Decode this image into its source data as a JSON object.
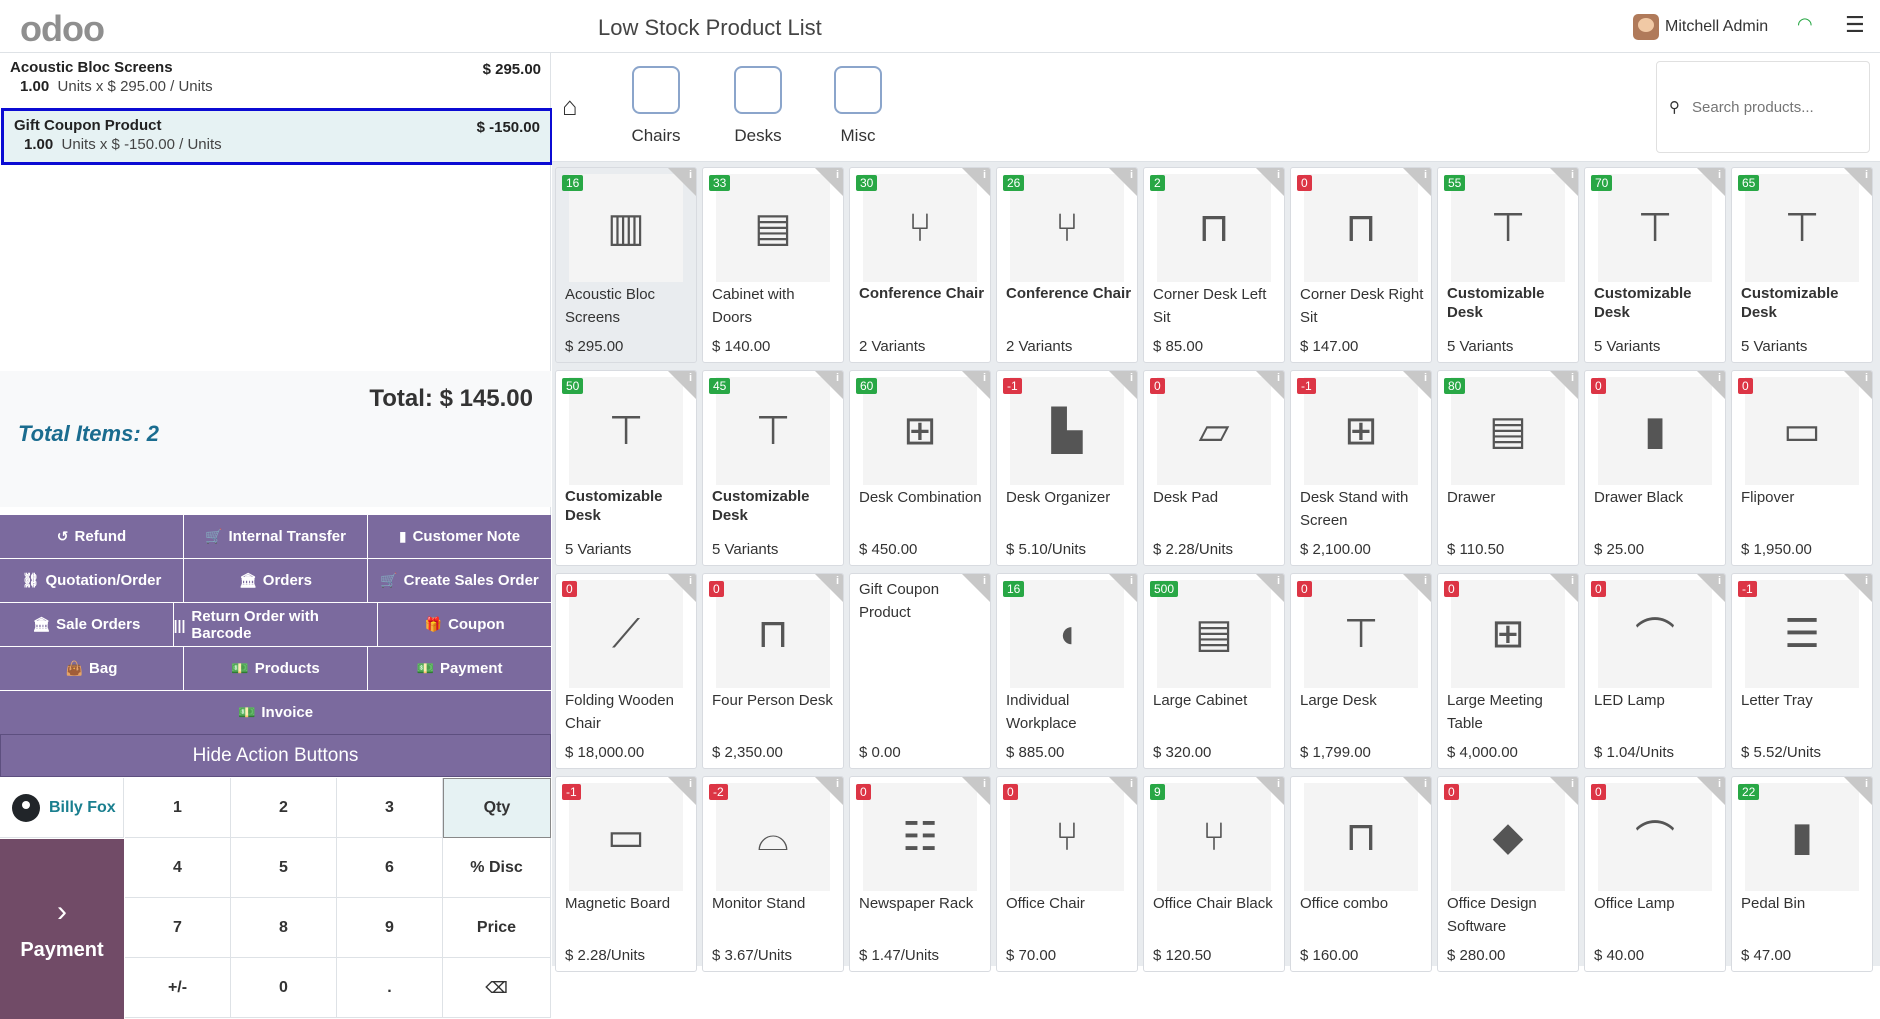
{
  "topbar": {
    "logo": "odoo",
    "title": "Low Stock Product List",
    "user": "Mitchell Admin"
  },
  "order": {
    "lines": [
      {
        "name": "Acoustic Bloc Screens",
        "price": "$ 295.00",
        "qty": "1.00",
        "unit_info": "Units x $ 295.00 / Units"
      },
      {
        "name": "Gift Coupon Product",
        "price": "$ -150.00",
        "qty": "1.00",
        "unit_info": "Units x $ -150.00 / Units"
      }
    ],
    "total": "Total: $ 145.00",
    "total_items": "Total Items: 2"
  },
  "actions": {
    "rows": [
      [
        {
          "label": "Refund",
          "icon": "undo-icon",
          "glyph": "↺"
        },
        {
          "label": "Internal Transfer",
          "icon": "cart-icon",
          "glyph": "🛒"
        },
        {
          "label": "Customer Note",
          "icon": "note-icon",
          "glyph": "▮"
        }
      ],
      [
        {
          "label": "Quotation/Order",
          "icon": "link-icon",
          "glyph": "⛓"
        },
        {
          "label": "Orders",
          "icon": "bank-icon",
          "glyph": "🏛"
        },
        {
          "label": "Create Sales Order",
          "icon": "cart-icon",
          "glyph": "🛒"
        }
      ],
      [
        {
          "label": "Sale Orders",
          "icon": "bank-icon",
          "glyph": "🏛"
        },
        {
          "label": "Return Order with Barcode",
          "icon": "barcode-icon",
          "glyph": "|||"
        },
        {
          "label": "Coupon",
          "icon": "gift-icon",
          "glyph": "🎁"
        }
      ],
      [
        {
          "label": "Bag",
          "icon": "bag-icon",
          "glyph": "👜"
        },
        {
          "label": "Products",
          "icon": "money-icon",
          "glyph": "💵"
        },
        {
          "label": "Payment",
          "icon": "money-icon",
          "glyph": "💵"
        }
      ],
      [
        {
          "label": "Invoice",
          "icon": "money-icon",
          "glyph": "💵"
        }
      ]
    ],
    "hide_label": "Hide Action Buttons"
  },
  "numpad": {
    "customer": "Billy Fox",
    "payment_label": "Payment",
    "keys": [
      "1",
      "2",
      "3",
      "Qty",
      "4",
      "5",
      "6",
      "% Disc",
      "7",
      "8",
      "9",
      "Price",
      "+/-",
      "0",
      ".",
      "⌫"
    ]
  },
  "categories": [
    "Chairs",
    "Desks",
    "Misc"
  ],
  "search": {
    "placeholder": "Search products..."
  },
  "products": [
    {
      "name": "Acoustic Bloc Screens",
      "price": "$ 295.00",
      "badge": "16",
      "badge_color": "green",
      "icon": "▥"
    },
    {
      "name": "Cabinet with Doors",
      "price": "$ 140.00",
      "badge": "33",
      "badge_color": "green",
      "icon": "▤"
    },
    {
      "name": "Conference Chair",
      "price": "2 Variants",
      "badge": "30",
      "badge_color": "green",
      "icon": "⑂",
      "bold": true
    },
    {
      "name": "Conference Chair",
      "price": "2 Variants",
      "badge": "26",
      "badge_color": "green",
      "icon": "⑂",
      "bold": true
    },
    {
      "name": "Corner Desk Left Sit",
      "price": "$ 85.00",
      "badge": "2",
      "badge_color": "green",
      "icon": "⊓"
    },
    {
      "name": "Corner Desk Right Sit",
      "price": "$ 147.00",
      "badge": "0",
      "badge_color": "red",
      "icon": "⊓"
    },
    {
      "name": "Customizable Desk",
      "price": "5 Variants",
      "badge": "55",
      "badge_color": "green",
      "icon": "⊤",
      "bold": true
    },
    {
      "name": "Customizable Desk",
      "price": "5 Variants",
      "badge": "70",
      "badge_color": "green",
      "icon": "⊤",
      "bold": true
    },
    {
      "name": "Customizable Desk",
      "price": "5 Variants",
      "badge": "65",
      "badge_color": "green",
      "icon": "⊤",
      "bold": true
    },
    {
      "name": "Customizable Desk",
      "price": "5 Variants",
      "badge": "50",
      "badge_color": "green",
      "icon": "⊤",
      "bold": true
    },
    {
      "name": "Customizable Desk",
      "price": "5 Variants",
      "badge": "45",
      "badge_color": "green",
      "icon": "⊤",
      "bold": true
    },
    {
      "name": "Desk Combination",
      "price": "$ 450.00",
      "badge": "60",
      "badge_color": "green",
      "icon": "⊞"
    },
    {
      "name": "Desk Organizer",
      "price": "$ 5.10/Units",
      "badge": "-1",
      "badge_color": "red",
      "icon": "▙"
    },
    {
      "name": "Desk Pad",
      "price": "$ 2.28/Units",
      "badge": "0",
      "badge_color": "red",
      "icon": "▱"
    },
    {
      "name": "Desk Stand with Screen",
      "price": "$ 2,100.00",
      "badge": "-1",
      "badge_color": "red",
      "icon": "⊞"
    },
    {
      "name": "Drawer",
      "price": "$ 110.50",
      "badge": "80",
      "badge_color": "green",
      "icon": "▤"
    },
    {
      "name": "Drawer Black",
      "price": "$ 25.00",
      "badge": "0",
      "badge_color": "red",
      "icon": "▮"
    },
    {
      "name": "Flipover",
      "price": "$ 1,950.00",
      "badge": "0",
      "badge_color": "red",
      "icon": "▭"
    },
    {
      "name": "Folding Wooden Chair",
      "price": "$ 18,000.00",
      "badge": "0",
      "badge_color": "red",
      "icon": "⟋"
    },
    {
      "name": "Four Person Desk",
      "price": "$ 2,350.00",
      "badge": "0",
      "badge_color": "red",
      "icon": "⊓"
    },
    {
      "name": "Gift Coupon Product",
      "price": "$ 0.00",
      "badge": "",
      "badge_color": "",
      "icon": "",
      "noimg": true
    },
    {
      "name": "Individual Workplace",
      "price": "$ 885.00",
      "badge": "16",
      "badge_color": "green",
      "icon": "◖"
    },
    {
      "name": "Large Cabinet",
      "price": "$ 320.00",
      "badge": "500",
      "badge_color": "green",
      "icon": "▤"
    },
    {
      "name": "Large Desk",
      "price": "$ 1,799.00",
      "badge": "0",
      "badge_color": "red",
      "icon": "⊤"
    },
    {
      "name": "Large Meeting Table",
      "price": "$ 4,000.00",
      "badge": "0",
      "badge_color": "red",
      "icon": "⊞"
    },
    {
      "name": "LED Lamp",
      "price": "$ 1.04/Units",
      "badge": "0",
      "badge_color": "red",
      "icon": "⌒"
    },
    {
      "name": "Letter Tray",
      "price": "$ 5.52/Units",
      "badge": "-1",
      "badge_color": "red",
      "icon": "☰"
    },
    {
      "name": "Magnetic Board",
      "price": "$ 2.28/Units",
      "badge": "-1",
      "badge_color": "red",
      "icon": "▭"
    },
    {
      "name": "Monitor Stand",
      "price": "$ 3.67/Units",
      "badge": "-2",
      "badge_color": "red",
      "icon": "⌓"
    },
    {
      "name": "Newspaper Rack",
      "price": "$ 1.47/Units",
      "badge": "0",
      "badge_color": "red",
      "icon": "☷"
    },
    {
      "name": "Office Chair",
      "price": "$ 70.00",
      "badge": "0",
      "badge_color": "red",
      "icon": "⑂"
    },
    {
      "name": "Office Chair Black",
      "price": "$ 120.50",
      "badge": "9",
      "badge_color": "green",
      "icon": "⑂"
    },
    {
      "name": "Office combo",
      "price": "$ 160.00",
      "badge": "",
      "badge_color": "",
      "icon": "⊓"
    },
    {
      "name": "Office Design Software",
      "price": "$ 280.00",
      "badge": "0",
      "badge_color": "red",
      "icon": "◆"
    },
    {
      "name": "Office Lamp",
      "price": "$ 40.00",
      "badge": "0",
      "badge_color": "red",
      "icon": "⌒"
    },
    {
      "name": "Pedal Bin",
      "price": "$ 47.00",
      "badge": "22",
      "badge_color": "green",
      "icon": "▮"
    }
  ]
}
